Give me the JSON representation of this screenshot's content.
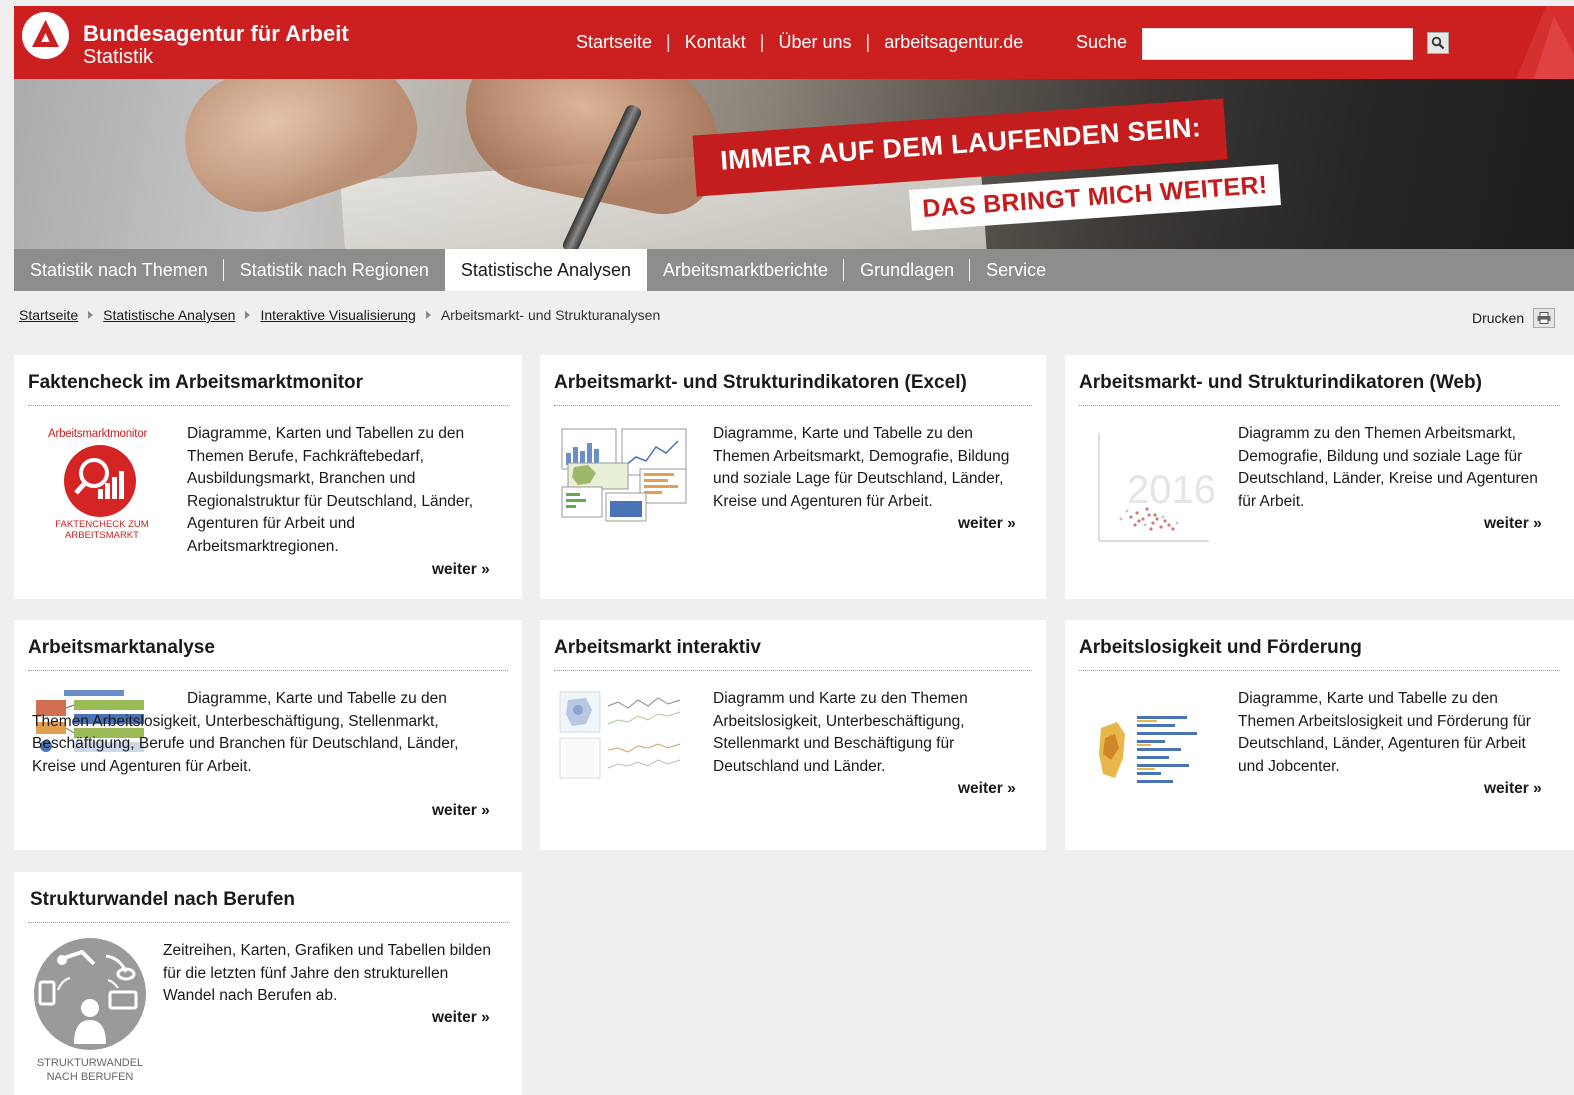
{
  "header": {
    "brand_title": "Bundesagentur für Arbeit",
    "brand_subtitle": "Statistik",
    "nav": [
      "Startseite",
      "Kontakt",
      "Über uns",
      "arbeitsagentur.de"
    ],
    "search_label": "Suche",
    "search_value": ""
  },
  "banner": {
    "slogan_line1": "IMMER AUF DEM LAUFENDEN SEIN:",
    "slogan_line2": "DAS BRINGT MICH WEITER!"
  },
  "main_nav": [
    {
      "label": "Statistik nach Themen",
      "active": false
    },
    {
      "label": "Statistik nach Regionen",
      "active": false
    },
    {
      "label": "Statistische Analysen",
      "active": true
    },
    {
      "label": "Arbeitsmarktberichte",
      "active": false
    },
    {
      "label": "Grundlagen",
      "active": false
    },
    {
      "label": "Service",
      "active": false
    }
  ],
  "breadcrumb": {
    "items": [
      "Startseite",
      "Statistische Analysen",
      "Interaktive Visualisierung"
    ],
    "current": "Arbeitsmarkt- und Strukturanalysen"
  },
  "print_label": "Drucken",
  "more_label": "weiter",
  "more_suffix": "»",
  "cards": [
    {
      "title": "Faktencheck im Arbeitsmarktmonitor",
      "thumb_label_top": "Arbeitsmarktmonitor",
      "thumb_label_bottom": "FAKTENCHECK ZUM ARBEITSMARKT",
      "description": "Diagramme, Karten und Tabellen zu den Themen Berufe, Fachkräftebedarf, Ausbildungsmarkt, Branchen und Regionalstruktur für Deutschland, Länder, Agenturen für Arbeit und Arbeitsmarktregionen."
    },
    {
      "title": "Arbeitsmarkt- und Strukturindikatoren (Excel)",
      "description": "Diagramme, Karte und Tabelle zu den Themen Arbeitsmarkt, Demografie, Bildung und soziale Lage für Deutschland, Länder, Kreise und Agenturen für Arbeit."
    },
    {
      "title": "Arbeitsmarkt- und Strukturindikatoren (Web)",
      "thumb_label": "2016",
      "description": "Diagramm zu den Themen Arbeitsmarkt, Demografie, Bildung und soziale Lage für Deutschland, Länder, Kreise und Agenturen für Arbeit."
    },
    {
      "title": "Arbeitsmarktanalyse",
      "description": "Diagramme, Karte und Tabelle zu den Themen Arbeitslosigkeit, Unterbeschäftigung, Stellenmarkt, Beschäftigung, Berufe und Branchen für Deutschland, Länder, Kreise und Agenturen für Arbeit."
    },
    {
      "title": "Arbeitsmarkt interaktiv",
      "description": "Diagramm und Karte zu den Themen Arbeitslosigkeit, Unterbeschäftigung, Stellenmarkt und Beschäftigung für Deutschland und Länder."
    },
    {
      "title": "Arbeitslosigkeit und Förderung",
      "description": "Diagramme, Karte und Tabelle zu den Themen Arbeitslosigkeit und Förderung für Deutschland, Länder, Agenturen für Arbeit und Jobcenter."
    },
    {
      "title": "Strukturwandel nach Berufen",
      "thumb_label": "STRUKTURWANDEL NACH BERUFEN",
      "description": "Zeitreihen, Karten, Grafiken und Tabellen bilden für die letzten fünf Jahre den strukturellen Wandel nach Berufen ab."
    }
  ],
  "colors": {
    "brand_red": "#cc1f1f",
    "nav_gray": "#8d8d8d",
    "page_bg": "#efefef"
  }
}
